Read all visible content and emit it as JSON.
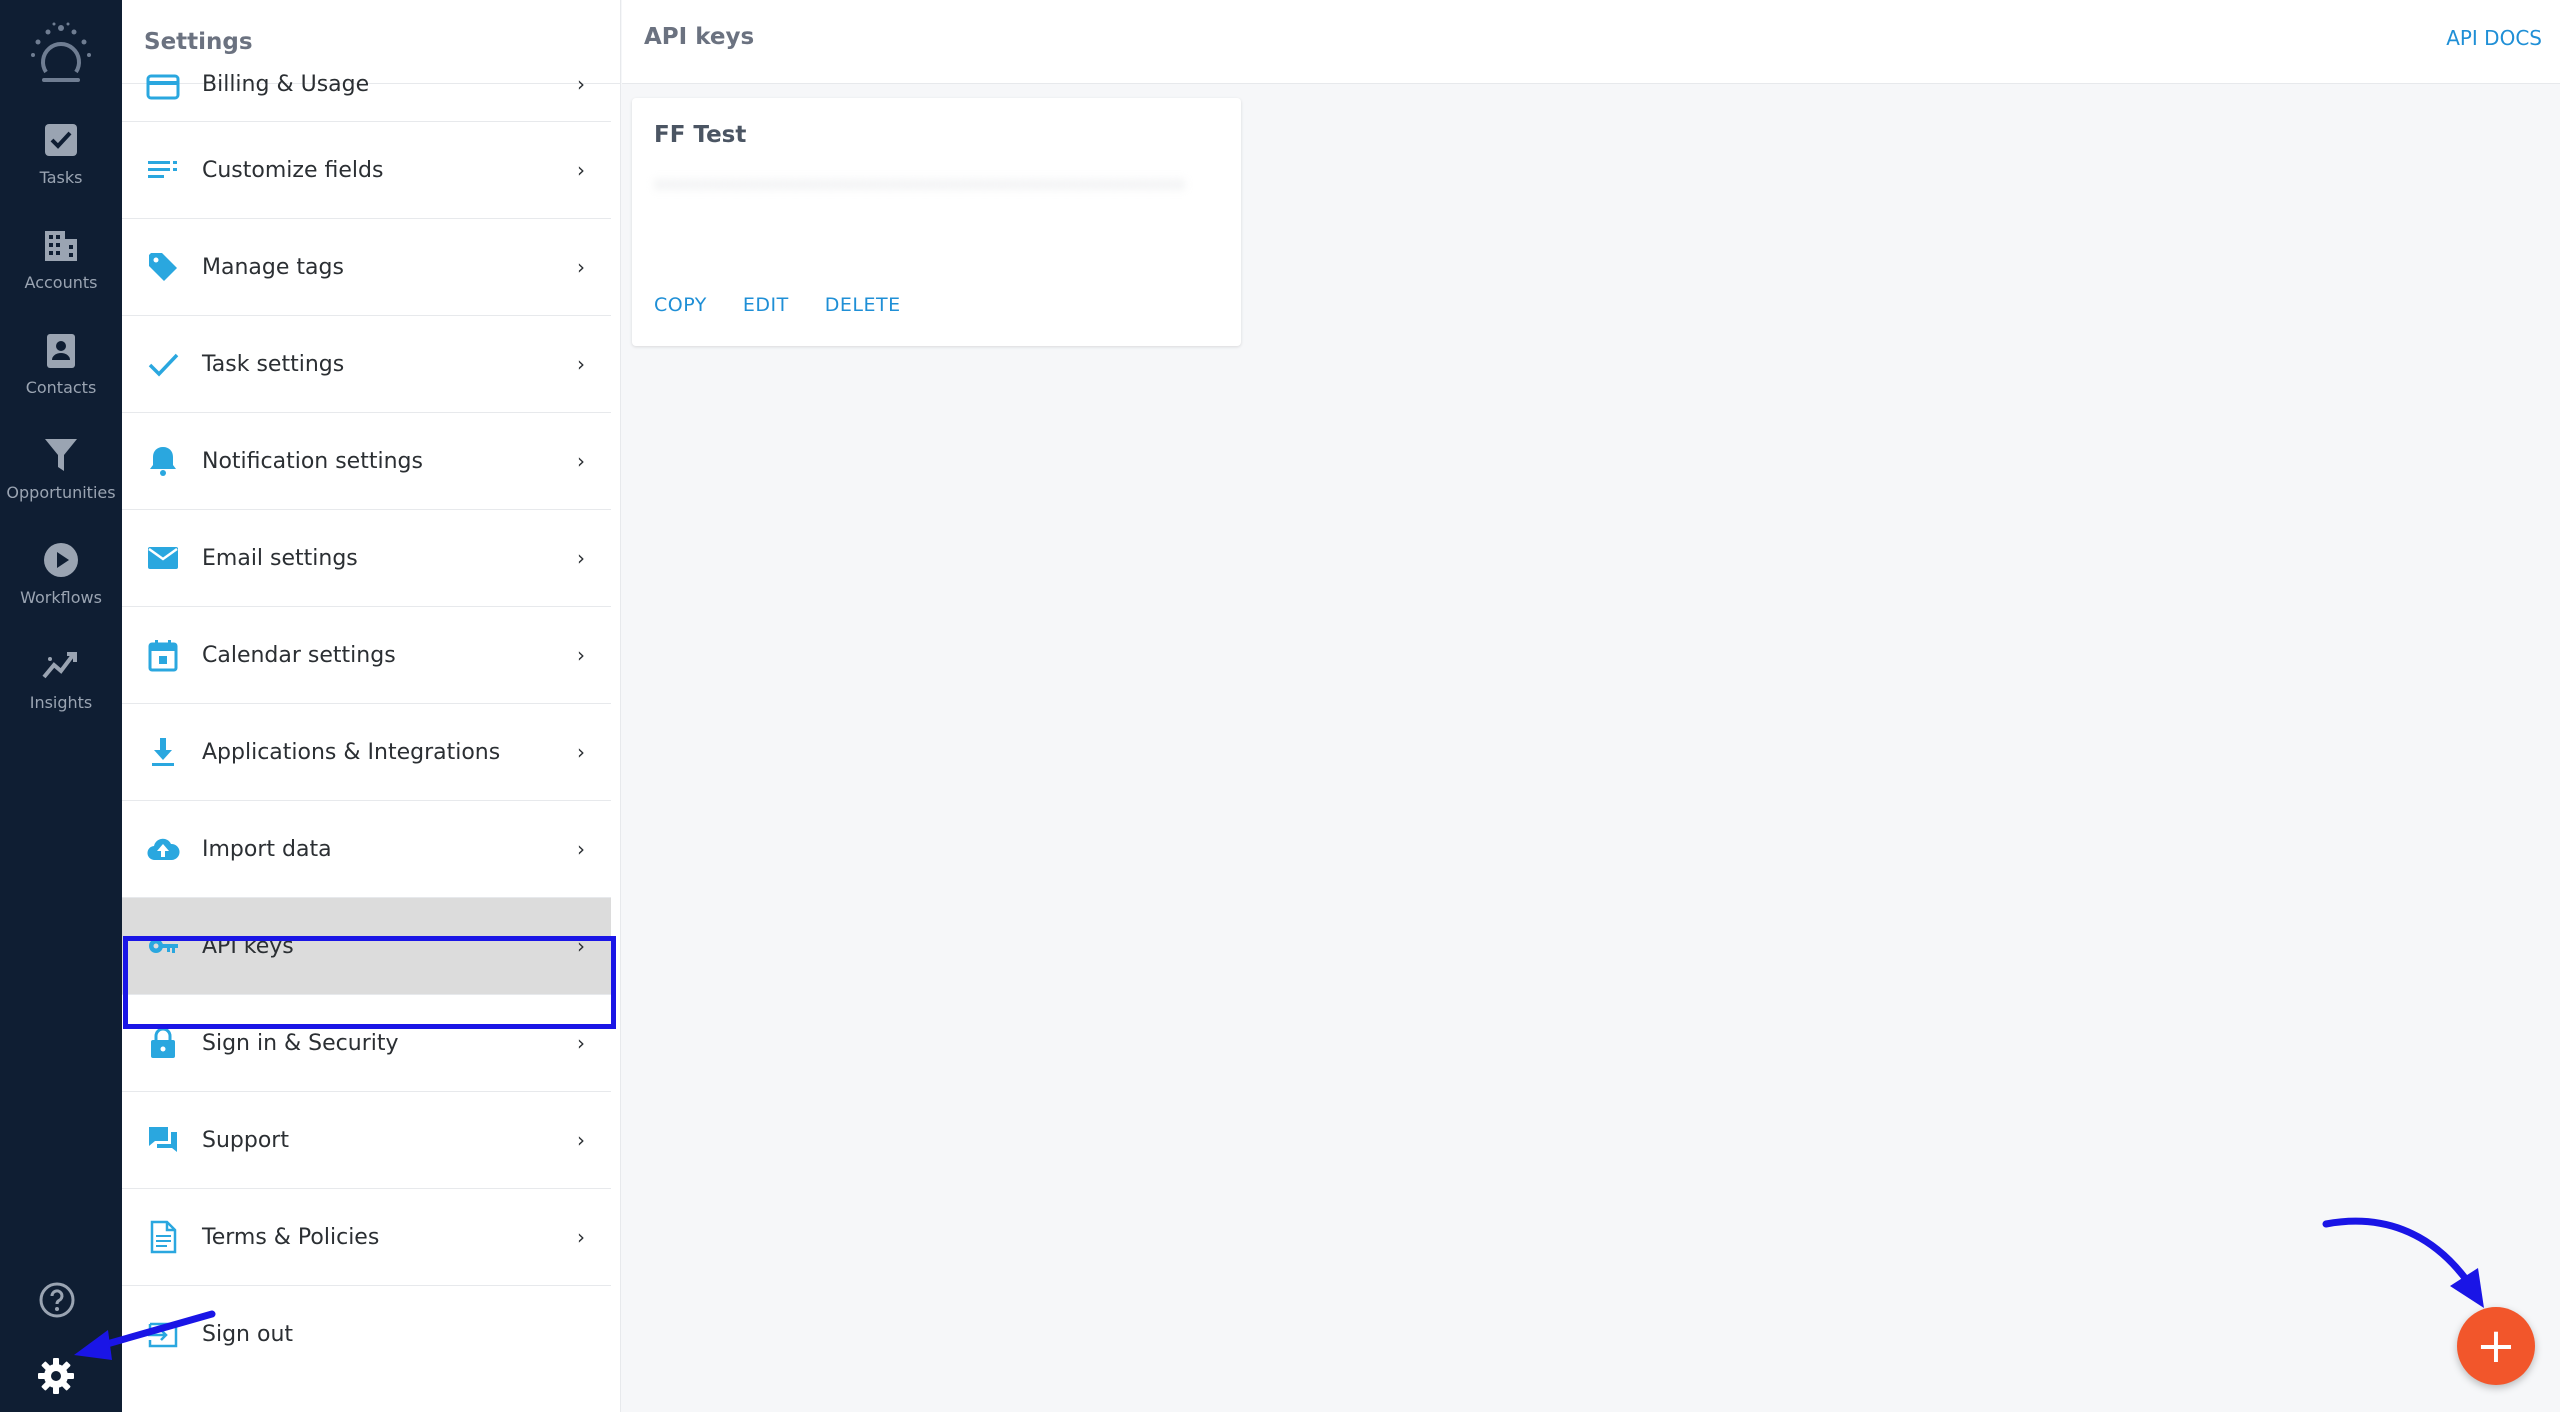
{
  "nav": {
    "items": [
      {
        "label": "Tasks",
        "icon": "tasks-check-icon"
      },
      {
        "label": "Accounts",
        "icon": "building-icon"
      },
      {
        "label": "Contacts",
        "icon": "contact-card-icon"
      },
      {
        "label": "Opportunities",
        "icon": "funnel-icon"
      },
      {
        "label": "Workflows",
        "icon": "play-circle-icon"
      },
      {
        "label": "Insights",
        "icon": "trend-chart-icon"
      }
    ],
    "help_icon": "help-circle-icon",
    "settings_icon": "gear-icon"
  },
  "settings_panel": {
    "title": "Settings",
    "items": [
      {
        "label": "Billing & Usage",
        "icon": "credit-card-icon"
      },
      {
        "label": "Customize fields",
        "icon": "fields-list-icon"
      },
      {
        "label": "Manage tags",
        "icon": "tag-icon"
      },
      {
        "label": "Task settings",
        "icon": "checkmark-icon"
      },
      {
        "label": "Notification settings",
        "icon": "bell-icon"
      },
      {
        "label": "Email settings",
        "icon": "envelope-icon"
      },
      {
        "label": "Calendar settings",
        "icon": "calendar-icon"
      },
      {
        "label": "Applications & Integrations",
        "icon": "download-icon"
      },
      {
        "label": "Import data",
        "icon": "cloud-upload-icon"
      },
      {
        "label": "API keys",
        "icon": "key-icon",
        "active": true
      },
      {
        "label": "Sign in & Security",
        "icon": "lock-icon"
      },
      {
        "label": "Support",
        "icon": "chat-bubbles-icon"
      },
      {
        "label": "Terms & Policies",
        "icon": "document-icon"
      },
      {
        "label": "Sign out",
        "icon": "sign-out-icon"
      }
    ],
    "chevron": "›"
  },
  "main": {
    "title": "API keys",
    "api_docs_label": "API DOCS",
    "card": {
      "name": "FF Test",
      "key_obscured": "••••••••••••••••••••••••••••••••••••••••••••••••••",
      "actions": {
        "copy": "COPY",
        "edit": "EDIT",
        "delete": "DELETE"
      }
    },
    "fab_label": "+"
  },
  "colors": {
    "rail_bg": "#0f1e33",
    "accent": "#1f8fd6",
    "icon_blue": "#2aa7df",
    "fab": "#f2562b",
    "highlight": "#1a15e6"
  }
}
